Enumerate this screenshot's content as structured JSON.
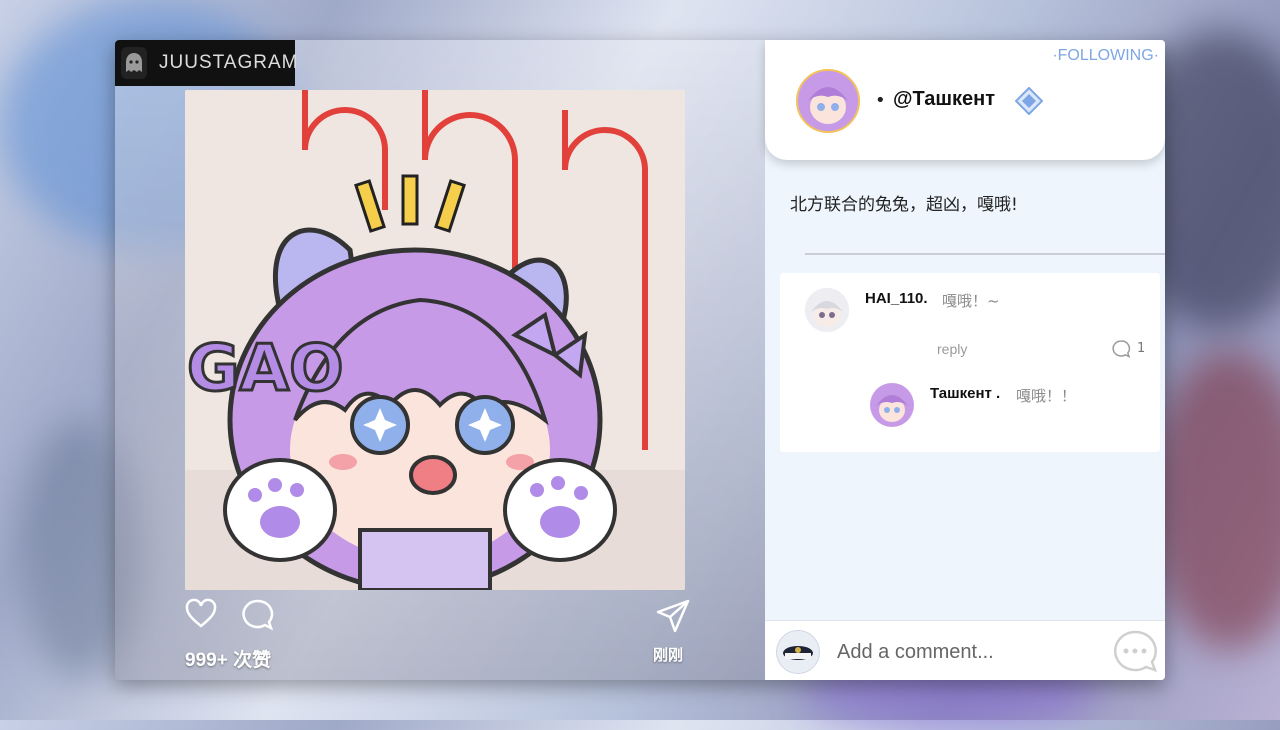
{
  "brand": {
    "name": "JUUSTAGRAM",
    "icon": "ghost-icon"
  },
  "post": {
    "image": {
      "subject": "chibi-bunny-character",
      "sticker_text": "GAO"
    },
    "actions": {
      "like_icon": "heart-icon",
      "comment_icon": "comment-bubble-icon",
      "share_icon": "paper-plane-icon"
    },
    "likes": "999+ 次赞",
    "time": "刚刚"
  },
  "profile": {
    "follow_label": "·FOLLOWING·",
    "bullet": "•",
    "username": "@Ташкент",
    "verified_icon": "verified-diamond-icon",
    "accent_color": "#7fa6e4"
  },
  "caption": "北方联合的兔兔，超凶，嘎哦!",
  "comments": [
    {
      "name": "HAI_110.",
      "text": "嘎哦！~",
      "reply_label": "reply",
      "reply_count": "1",
      "replies": [
        {
          "name": "Ташкент .",
          "text": "嘎哦！！"
        }
      ]
    }
  ],
  "comment_input": {
    "placeholder": "Add a comment...",
    "send_icon": "chat-bubble-icon"
  }
}
